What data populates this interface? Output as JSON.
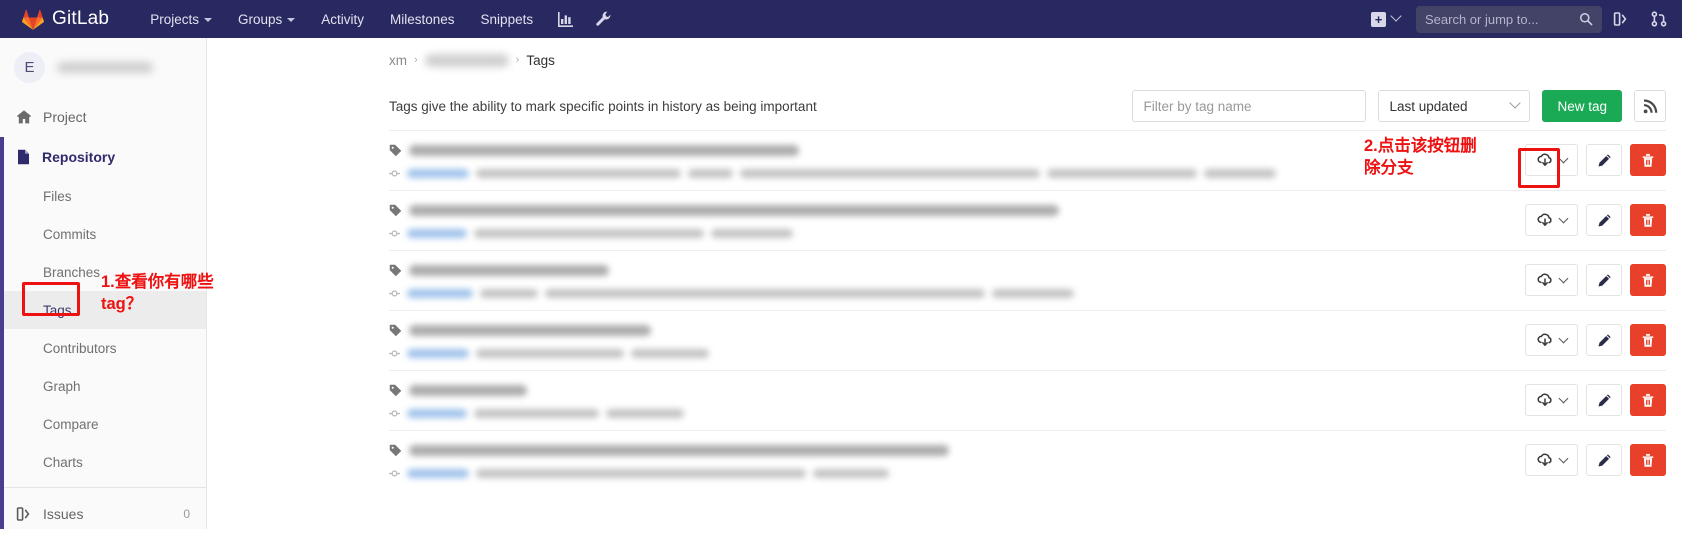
{
  "navbar": {
    "brand": "GitLab",
    "logo_icon": "gitlab-fox-logo",
    "links": [
      {
        "label": "Projects",
        "has_caret": true
      },
      {
        "label": "Groups",
        "has_caret": true
      },
      {
        "label": "Activity",
        "has_caret": false
      },
      {
        "label": "Milestones",
        "has_caret": false
      },
      {
        "label": "Snippets",
        "has_caret": false
      }
    ],
    "icons": [
      {
        "name": "analytics-chart-icon"
      },
      {
        "name": "wrench-admin-icon"
      }
    ],
    "new_button": {
      "name": "plus-icon",
      "label": "+"
    },
    "search": {
      "placeholder": "Search or jump to...",
      "icon": "search-magnifier-icon"
    },
    "right_icons": [
      {
        "name": "issues-board-icon"
      },
      {
        "name": "merge-requests-icon"
      }
    ]
  },
  "sidebar": {
    "project": {
      "avatar_initial": "E",
      "name_redacted": true
    },
    "items": [
      {
        "label": "Project",
        "icon": "home-icon",
        "type": "top",
        "active": false
      },
      {
        "label": "Repository",
        "icon": "file-document-icon",
        "type": "top",
        "active": true
      },
      {
        "label": "Files",
        "type": "sub",
        "selected": false
      },
      {
        "label": "Commits",
        "type": "sub",
        "selected": false
      },
      {
        "label": "Branches",
        "type": "sub",
        "selected": false
      },
      {
        "label": "Tags",
        "type": "sub",
        "selected": true
      },
      {
        "label": "Contributors",
        "type": "sub",
        "selected": false
      },
      {
        "label": "Graph",
        "type": "sub",
        "selected": false
      },
      {
        "label": "Compare",
        "type": "sub",
        "selected": false
      },
      {
        "label": "Charts",
        "type": "sub",
        "selected": false
      },
      {
        "label": "Issues",
        "icon": "issues-icon",
        "type": "top",
        "active": false,
        "count": "0"
      }
    ]
  },
  "breadcrumb": {
    "root": "xm",
    "separator": "›",
    "middle_redacted": true,
    "current": "Tags"
  },
  "toolbar": {
    "description": "Tags give the ability to mark specific points in history as being important",
    "filter_placeholder": "Filter by tag name",
    "filter_value": "",
    "sort_value": "Last updated",
    "new_tag_label": "New tag",
    "new_tag_color": "#1aaa55",
    "rss_icon": "rss-feed-icon"
  },
  "tags": {
    "row_actions": {
      "download_icon": "cloud-download-icon",
      "download_caret_icon": "chevron-down-icon",
      "edit_icon": "pencil-edit-icon",
      "delete_icon": "trash-delete-icon",
      "delete_color": "#e9402b"
    },
    "rows": [
      {
        "tag_icon": "tag-icon",
        "name_width": 390,
        "meta_widths": [
          62,
          205,
          45,
          300,
          150,
          72
        ],
        "redacted": true
      },
      {
        "tag_icon": "tag-icon",
        "name_width": 650,
        "meta_widths": [
          60,
          230,
          82
        ],
        "redacted": true
      },
      {
        "tag_icon": "tag-icon",
        "name_width": 200,
        "meta_widths": [
          66,
          58,
          440,
          82
        ],
        "redacted": true
      },
      {
        "tag_icon": "tag-icon",
        "name_width": 242,
        "meta_widths": [
          62,
          148,
          78
        ],
        "redacted": true
      },
      {
        "tag_icon": "tag-icon",
        "name_width": 118,
        "meta_widths": [
          60,
          125,
          78
        ],
        "redacted": true
      },
      {
        "tag_icon": "tag-icon",
        "name_width": 540,
        "meta_widths": [
          62,
          330,
          76
        ],
        "redacted": true
      }
    ]
  },
  "annotations": [
    {
      "id": "annotation-tags-nav",
      "text": "1.查看你有哪些\ntag？",
      "color": "#ee1111",
      "box_target": "sidebar-item-tags"
    },
    {
      "id": "annotation-delete-button",
      "text": "2.点击该按钮删\n除分支",
      "color": "#ee1111",
      "box_target": "tag-delete-button-row-1"
    }
  ]
}
